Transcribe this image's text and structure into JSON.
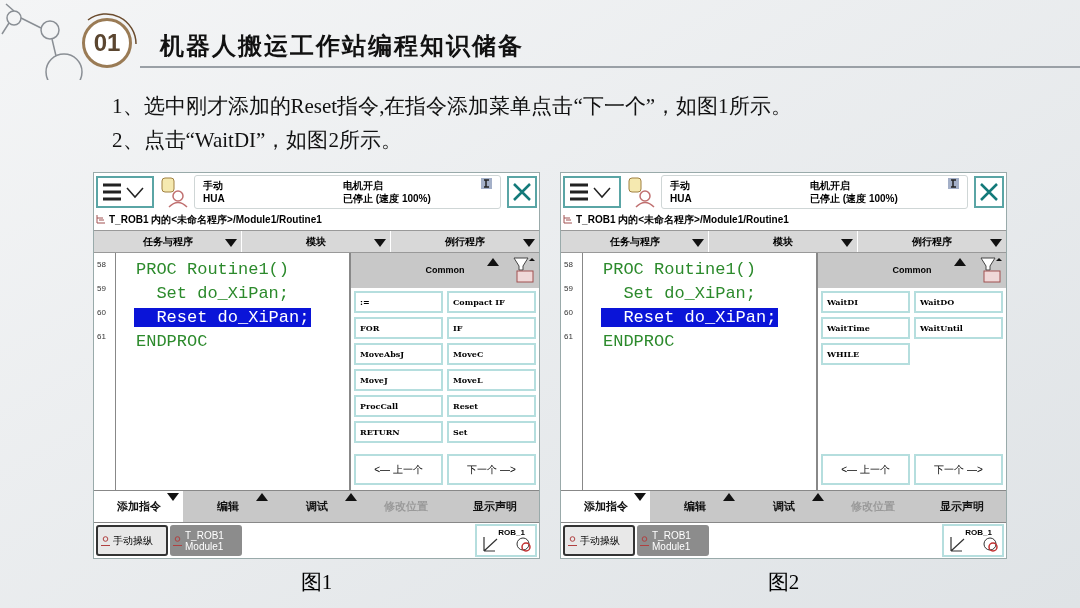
{
  "header": {
    "badge": "01",
    "title": "机器人搬运工作站编程知识储备"
  },
  "instructions": [
    "1、选中刚才添加的Reset指令,在指令添加菜单点击“下一个”，如图1所示。",
    "2、点击“WaitDI”，如图2所示。"
  ],
  "figures": [
    {
      "status": {
        "mode": "手动",
        "system": "HUA",
        "motor": "电机开启",
        "state": "已停止 (速度 100%)"
      },
      "path": "T_ROB1 内的<未命名程序>/Module1/Routine1",
      "dropdowns": [
        "任务与程序",
        "模块",
        "例行程序"
      ],
      "code_lines": [
        {
          "number": "58",
          "text": "PROC Routine1()",
          "selected": false
        },
        {
          "number": "59",
          "text": "  Set do_XiPan;",
          "selected": false
        },
        {
          "number": "60",
          "text": "  Reset do_XiPan;",
          "selected": true
        },
        {
          "number": "61",
          "text": "ENDPROC",
          "selected": false
        }
      ],
      "panel": {
        "title": "Common",
        "items": [
          ":=",
          "Compact IF",
          "FOR",
          "IF",
          "MoveAbsJ",
          "MoveC",
          "MoveJ",
          "MoveL",
          "ProcCall",
          "Reset",
          "RETURN",
          "Set"
        ],
        "prev": "<— 上一个",
        "next": "下一个 —>"
      },
      "menu": [
        {
          "label": "添加指令",
          "selected": true,
          "disabled": false
        },
        {
          "label": "编辑",
          "selected": false,
          "disabled": false
        },
        {
          "label": "调试",
          "selected": false,
          "disabled": false
        },
        {
          "label": "修改位置",
          "selected": false,
          "disabled": true
        },
        {
          "label": "显示声明",
          "selected": false,
          "disabled": false
        }
      ],
      "taskbar": [
        {
          "lines": [
            "手动操纵"
          ],
          "selected": true
        },
        {
          "lines": [
            "T_ROB1",
            "Module1"
          ],
          "selected": false
        }
      ],
      "unit": "ROB_1",
      "caption": "图1"
    },
    {
      "status": {
        "mode": "手动",
        "system": "HUA",
        "motor": "电机开启",
        "state": "已停止 (速度 100%)"
      },
      "path": "T_ROB1 内的<未命名程序>/Module1/Routine1",
      "dropdowns": [
        "任务与程序",
        "模块",
        "例行程序"
      ],
      "code_lines": [
        {
          "number": "58",
          "text": "PROC Routine1()",
          "selected": false
        },
        {
          "number": "59",
          "text": "  Set do_XiPan;",
          "selected": false
        },
        {
          "number": "60",
          "text": "  Reset do_XiPan;",
          "selected": true
        },
        {
          "number": "61",
          "text": "ENDPROC",
          "selected": false
        }
      ],
      "panel": {
        "title": "Common",
        "items": [
          "WaitDI",
          "WaitDO",
          "WaitTime",
          "WaitUntil",
          "WHILE"
        ],
        "prev": "<— 上一个",
        "next": "下一个 —>"
      },
      "menu": [
        {
          "label": "添加指令",
          "selected": true,
          "disabled": false
        },
        {
          "label": "编辑",
          "selected": false,
          "disabled": false
        },
        {
          "label": "调试",
          "selected": false,
          "disabled": false
        },
        {
          "label": "修改位置",
          "selected": false,
          "disabled": true
        },
        {
          "label": "显示声明",
          "selected": false,
          "disabled": false
        }
      ],
      "taskbar": [
        {
          "lines": [
            "手动操纵"
          ],
          "selected": true
        },
        {
          "lines": [
            "T_ROB1",
            "Module1"
          ],
          "selected": false
        }
      ],
      "unit": "ROB_1",
      "caption": "图2"
    }
  ]
}
